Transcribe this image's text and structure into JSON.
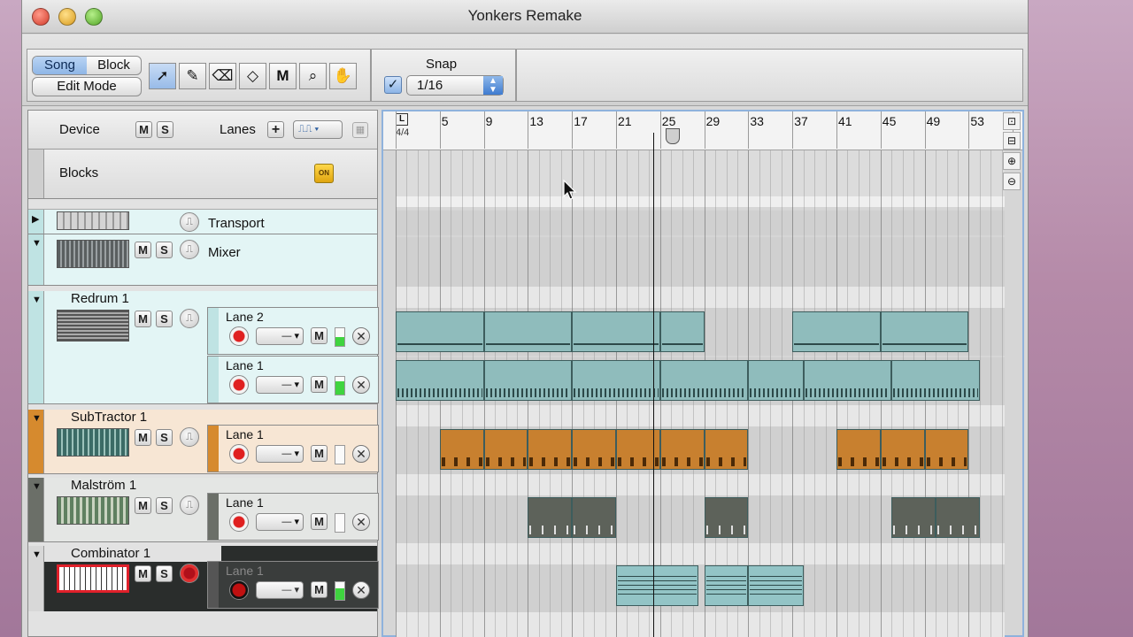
{
  "window": {
    "title": "Yonkers Remake"
  },
  "mode": {
    "song_label": "Song",
    "block_label": "Block",
    "edit_mode_label": "Edit Mode"
  },
  "tools": {
    "arrow": "➚",
    "pencil": "✎",
    "eraser": "⌫",
    "razor": "◇",
    "mute": "M",
    "magnify": "⌕",
    "hand": "✋"
  },
  "snap": {
    "label": "Snap",
    "checked": true,
    "value": "1/16"
  },
  "header": {
    "device_label": "Device",
    "m_label": "M",
    "s_label": "S",
    "lanes_label": "Lanes",
    "add_label": "+"
  },
  "blocks": {
    "label": "Blocks",
    "toggle_label": "ON"
  },
  "ruler": {
    "start_marker": "L",
    "time_signature": "4/4",
    "bars": [
      "5",
      "9",
      "13",
      "17",
      "21",
      "25",
      "29",
      "33",
      "37",
      "41",
      "45",
      "49",
      "53"
    ]
  },
  "tracks": {
    "transport": {
      "name": "Transport"
    },
    "mixer": {
      "name": "Mixer"
    },
    "redrum": {
      "name": "Redrum 1",
      "lane2": "Lane 2",
      "lane1": "Lane 1"
    },
    "subtractor": {
      "name": "SubTractor 1",
      "lane1": "Lane 1"
    },
    "malstrom": {
      "name": "Malström 1",
      "lane1": "Lane 1"
    },
    "combinator": {
      "name": "Combinator 1",
      "lane1": "Lane 1"
    }
  },
  "colors": {
    "redrum_clip": "#8fbcbc",
    "subtractor_clip": "#c8802f",
    "malstrom_clip": "#5d625a",
    "combinator_clip": "#93c4c6",
    "track_teal": "#e3f5f5",
    "track_orange": "#f7e6d4",
    "track_gray": "#e4e6e4"
  }
}
